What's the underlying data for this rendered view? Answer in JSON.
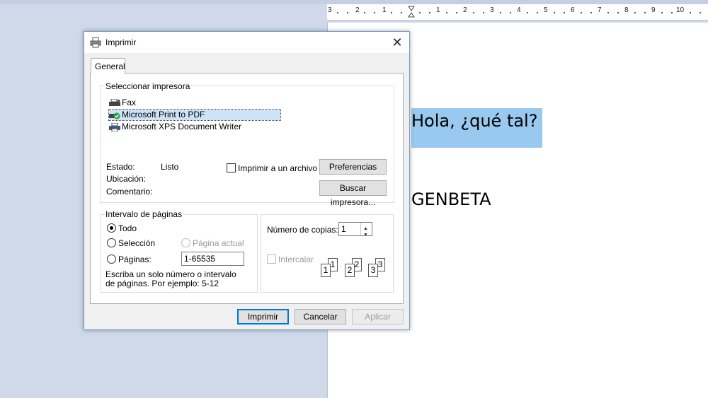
{
  "ruler": {
    "labels_left": [
      "3",
      "2",
      "1"
    ],
    "labels_right": [
      "1",
      "2",
      "3",
      "4",
      "5",
      "6",
      "7",
      "8",
      "9",
      "10"
    ]
  },
  "document": {
    "line1": "Hola, ¿qué tal?",
    "line2": "GENBETA",
    "highlight_color": "#99c9ef"
  },
  "dialog": {
    "title": "Imprimir",
    "close_icon": "close-icon",
    "tab": "General",
    "select_printer": {
      "legend": "Seleccionar impresora",
      "printers": [
        {
          "name": "Fax",
          "icon": "fax-icon",
          "selected": false
        },
        {
          "name": "Microsoft Print to PDF",
          "icon": "printer-default-icon",
          "selected": true
        },
        {
          "name": "Microsoft XPS Document Writer",
          "icon": "printer-icon",
          "selected": false
        }
      ],
      "status_label": "Estado:",
      "status_value": "Listo",
      "location_label": "Ubicación:",
      "comment_label": "Comentario:",
      "print_to_file_label": "Imprimir a un archivo",
      "print_to_file_checked": false,
      "preferences_button": "Preferencias",
      "find_printer_button": "Buscar impresora..."
    },
    "page_range": {
      "legend": "Intervalo de páginas",
      "all_label": "Todo",
      "selection_label": "Selección",
      "current_page_label": "Página actual",
      "pages_label": "Páginas:",
      "pages_value": "1-65535",
      "hint": "Escriba un solo número o intervalo de páginas. Por ejemplo: 5-12",
      "selected": "Todo"
    },
    "copies": {
      "label": "Número de copias:",
      "value": "1",
      "collate_label": "Intercalar",
      "collate_checked": false,
      "collate_pages": [
        "1",
        "1",
        "2",
        "2",
        "3",
        "3"
      ]
    },
    "buttons": {
      "print": "Imprimir",
      "cancel": "Cancelar",
      "apply": "Aplicar"
    }
  },
  "colors": {
    "accent": "#0078d7",
    "workspace_bg": "#cfd9ea"
  }
}
